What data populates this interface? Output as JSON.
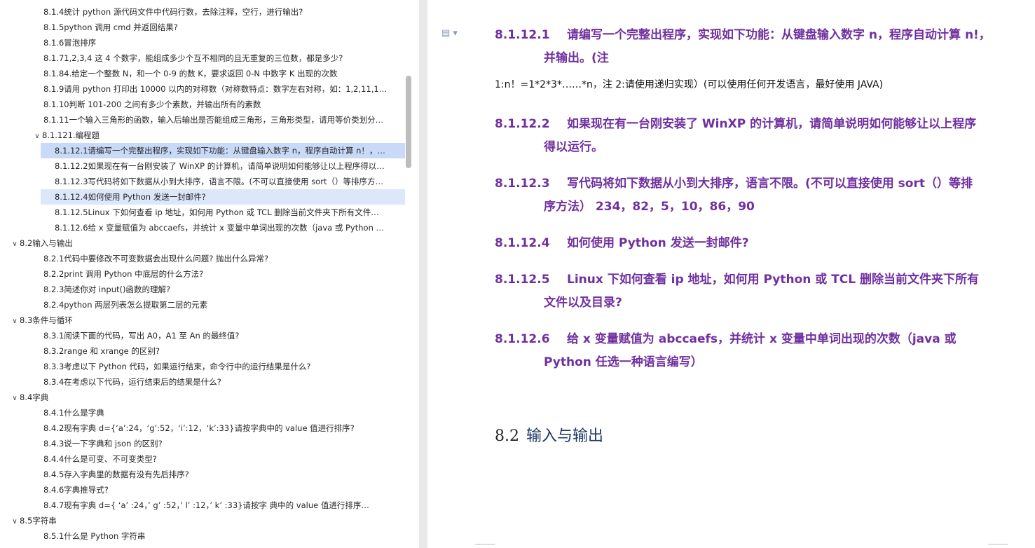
{
  "nav": {
    "items": [
      {
        "level": 2,
        "text": "8.1.4统计 python 源代码文件中代码行数，去除注释，空行，进行输出?"
      },
      {
        "level": 2,
        "text": "8.1.5python 调用 cmd 并返回结果?"
      },
      {
        "level": 2,
        "text": "8.1.6冒泡排序"
      },
      {
        "level": 2,
        "text": "8.1.71,2,3,4 这 4 个数字，能组成多少个互不相同的且无重复的三位数，都是多少?"
      },
      {
        "level": 2,
        "text": "8.1.84.给定一个整数 N，和一个 0-9 的数 K，要求返回 0-N 中数字 K 出现的次数"
      },
      {
        "level": 2,
        "text": "8.1.9请用 python 打印出 10000 以内的对称数（对称数特点：数字左右对称，如：1,2,11,1…"
      },
      {
        "level": 2,
        "text": "8.1.10判断 101-200 之间有多少个素数，并输出所有的素数"
      },
      {
        "level": 2,
        "text": "8.1.11一个输入三角形的函数，输入后输出是否能组成三角形，三角形类型，请用等价类划分…"
      },
      {
        "level": 2,
        "text": "8.1.121.编程题",
        "chev": "∨"
      },
      {
        "level": 3,
        "text": "8.1.12.1请编写一个完整出程序，实现如下功能：从键盘输入数字 n，程序自动计算 n！，…",
        "selected": true
      },
      {
        "level": 3,
        "text": "8.1.12.2如果现在有一台刚安装了 WinXP 的计算机，请简单说明如何能够让以上程序得以…"
      },
      {
        "level": 3,
        "text": "8.1.12.3写代码将如下数据从小到大排序，语言不限。(不可以直接使用 sort（）等排序方…"
      },
      {
        "level": 3,
        "text": "8.1.12.4如何使用 Python 发送一封邮件?",
        "hover": true
      },
      {
        "level": 3,
        "text": "8.1.12.5Linux 下如何查看 ip 地址，如何用 Python 或 TCL 删除当前文件夹下所有文件…"
      },
      {
        "level": 3,
        "text": "8.1.12.6给 x 变量赋值为 abccaefs，并统计 x 变量中单词出现的次数（java 或 Python …"
      },
      {
        "level": 1,
        "text": "8.2输入与输出",
        "chev": "∨"
      },
      {
        "level": 2,
        "text": "8.2.1代码中要修改不可变数据会出现什么问题? 抛出什么异常?"
      },
      {
        "level": 2,
        "text": "8.2.2print 调用 Python 中底层的什么方法?"
      },
      {
        "level": 2,
        "text": "8.2.3简述你对 input()函数的理解?"
      },
      {
        "level": 2,
        "text": "8.2.4python 两层列表怎么提取第二层的元素"
      },
      {
        "level": 1,
        "text": "8.3条件与循环",
        "chev": "∨"
      },
      {
        "level": 2,
        "text": "8.3.1阅读下面的代码，写出 A0，A1 至 An 的最终值?"
      },
      {
        "level": 2,
        "text": "8.3.2range 和 xrange 的区别?"
      },
      {
        "level": 2,
        "text": "8.3.3考虑以下 Python 代码，如果运行结束，命令行中的运行结果是什么?"
      },
      {
        "level": 2,
        "text": "8.3.4在考虑以下代码，运行结束后的结果是什么?"
      },
      {
        "level": 1,
        "text": "8.4字典",
        "chev": "∨"
      },
      {
        "level": 2,
        "text": "8.4.1什么是字典"
      },
      {
        "level": 2,
        "text": "8.4.2现有字典 d={‘a’:24，‘g’:52，‘i’:12，‘k’:33}请按字典中的 value 值进行排序?"
      },
      {
        "level": 2,
        "text": "8.4.3说一下字典和 json 的区别?"
      },
      {
        "level": 2,
        "text": "8.4.4什么是可变、不可变类型?"
      },
      {
        "level": 2,
        "text": "8.4.5存入字典里的数据有没有先后排序?"
      },
      {
        "level": 2,
        "text": "8.4.6字典推导式?"
      },
      {
        "level": 2,
        "text": "8.4.7现有字典 d={ ‘a’ :24，’ g’ :52，’ l’ :12，’ k’ :33}请按字 典中的 value 值进行排序…"
      },
      {
        "level": 1,
        "text": "8.5字符串",
        "chev": "∨"
      },
      {
        "level": 2,
        "text": "8.5.1什么是 Python 字符串"
      }
    ]
  },
  "doc": {
    "headings": [
      {
        "num": "8.1.12.1",
        "line1": "请编写一个完整出程序，实现如下功能：从键盘输入数字 n，程序自动计算 n!，",
        "line2": "并输出。(注"
      },
      {
        "num": "8.1.12.2",
        "line1": "如果现在有一台刚安装了 WinXP 的计算机，请简单说明如何能够让以上程序",
        "line2": "得以运行。"
      },
      {
        "num": "8.1.12.3",
        "line1": "写代码将如下数据从小到大排序，语言不限。(不可以直接使用 sort（）等排",
        "line2": "序方法） 234，82，5，10，86，90"
      },
      {
        "num": "8.1.12.4",
        "line1": "如何使用 Python 发送一封邮件?",
        "line2": ""
      },
      {
        "num": "8.1.12.5",
        "line1": "Linux 下如何查看 ip 地址，如何用 Python 或 TCL 删除当前文件夹下所有",
        "line2": "文件以及目录?"
      },
      {
        "num": "8.1.12.6",
        "line1": "给 x 变量赋值为 abccaefs，并统计 x 变量中单词出现的次数（java 或",
        "line2": "Python 任选一种语言编写）"
      }
    ],
    "plain_line": "1:n！=1*2*3*……*n，注 2:请使用递归实现）(可以使用任何开发语言，最好使用 JAVA)",
    "section": {
      "num": "8.2",
      "title": "输入与输出"
    }
  },
  "colors": {
    "heading": "#7030a0",
    "section": "#1f3864",
    "selected": "#c9daf8"
  }
}
